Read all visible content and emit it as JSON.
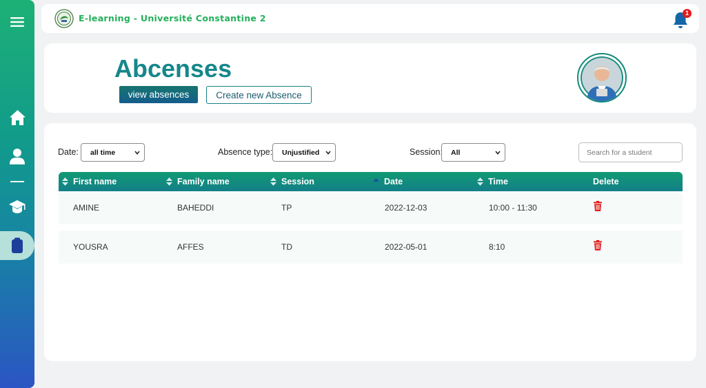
{
  "app": {
    "brand": "E-learning - Université Constantine 2",
    "notification_count": "1"
  },
  "header": {
    "title": "Abcenses",
    "view_button": "view absences",
    "create_button": "Create new Absence"
  },
  "filters": {
    "date_label": "Date:",
    "date_value": "all time",
    "type_label": "Absence type:",
    "type_value": "Unjustified",
    "session_label": "Session:",
    "session_value": "All",
    "search_placeholder": "Search for a student"
  },
  "table": {
    "columns": [
      "First name",
      "Family name",
      "Session",
      "Date",
      "Time",
      "Delete"
    ],
    "rows": [
      {
        "first": "AMINE",
        "family": "BAHEDDI",
        "session": "TP",
        "date": "2022-12-03",
        "time": "10:00 - 11:30"
      },
      {
        "first": "YOUSRA",
        "family": "AFFES",
        "session": "TD",
        "date": "2022-05-01",
        "time": "8:10"
      }
    ]
  },
  "colors": {
    "accent": "#16878b",
    "brand": "#22b05a",
    "danger": "#e21b1b"
  }
}
